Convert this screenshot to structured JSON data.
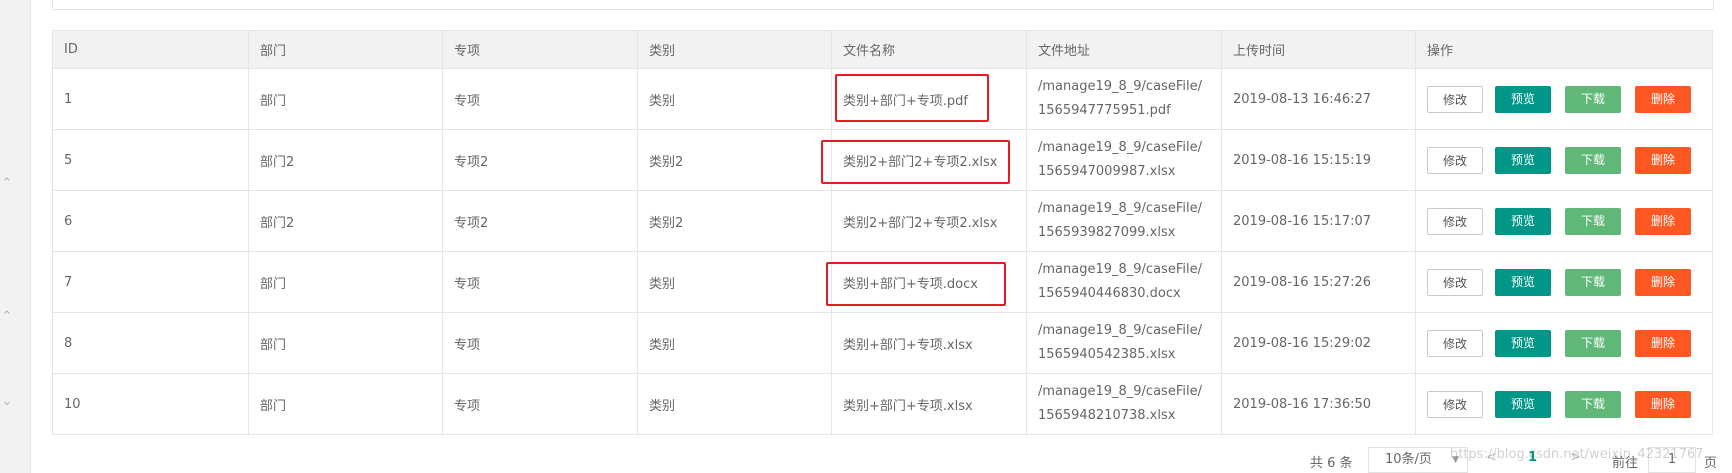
{
  "table": {
    "columns": [
      "ID",
      "部门",
      "专项",
      "类别",
      "文件名称",
      "文件地址",
      "上传时间",
      "操作"
    ],
    "rows": [
      {
        "id": "1",
        "dept": "部门",
        "special": "专项",
        "category": "类别",
        "file_name": "类别+部门+专项.pdf",
        "file_path": "/manage19_8_9/caseFile/1565947775951.pdf",
        "upload_time": "2019-08-13 16:46:27",
        "highlighted": true
      },
      {
        "id": "5",
        "dept": "部门2",
        "special": "专项2",
        "category": "类别2",
        "file_name": "类别2+部门2+专项2.xlsx",
        "file_path": "/manage19_8_9/caseFile/1565947009987.xlsx",
        "upload_time": "2019-08-16 15:15:19",
        "highlighted": true
      },
      {
        "id": "6",
        "dept": "部门2",
        "special": "专项2",
        "category": "类别2",
        "file_name": "类别2+部门2+专项2.xlsx",
        "file_path": "/manage19_8_9/caseFile/1565939827099.xlsx",
        "upload_time": "2019-08-16 15:17:07",
        "highlighted": false
      },
      {
        "id": "7",
        "dept": "部门",
        "special": "专项",
        "category": "类别",
        "file_name": "类别+部门+专项.docx",
        "file_path": "/manage19_8_9/caseFile/1565940446830.docx",
        "upload_time": "2019-08-16 15:27:26",
        "highlighted": true
      },
      {
        "id": "8",
        "dept": "部门",
        "special": "专项",
        "category": "类别",
        "file_name": "类别+部门+专项.xlsx",
        "file_path": "/manage19_8_9/caseFile/1565940542385.xlsx",
        "upload_time": "2019-08-16 15:29:02",
        "highlighted": false
      },
      {
        "id": "10",
        "dept": "部门",
        "special": "专项",
        "category": "类别",
        "file_name": "类别+部门+专项.xlsx",
        "file_path": "/manage19_8_9/caseFile/1565948210738.xlsx",
        "upload_time": "2019-08-16 17:36:50",
        "highlighted": false
      }
    ],
    "actions": {
      "edit": "修改",
      "preview": "预览",
      "download": "下载",
      "delete": "删除"
    }
  },
  "pagination": {
    "total_text": "共 6 条",
    "limit_text": "10条/页",
    "prev_icon": "<",
    "current_page": "1",
    "next_icon": ">",
    "goto_label": "前往",
    "goto_value": "1",
    "page_label": "页"
  },
  "watermark": "https://blog.csdn.net/weixin_42321767",
  "colors": {
    "preview": "#009688",
    "download": "#5fb878",
    "delete": "#ff5722",
    "highlight_box": "#e51c23",
    "header_bg": "#f2f2f2"
  },
  "icons": {
    "sidebar_chevrons": [
      "chevron-up-icon",
      "chevron-up-icon",
      "chevron-down-icon"
    ],
    "limit_dropdown": "caret-down-icon"
  }
}
